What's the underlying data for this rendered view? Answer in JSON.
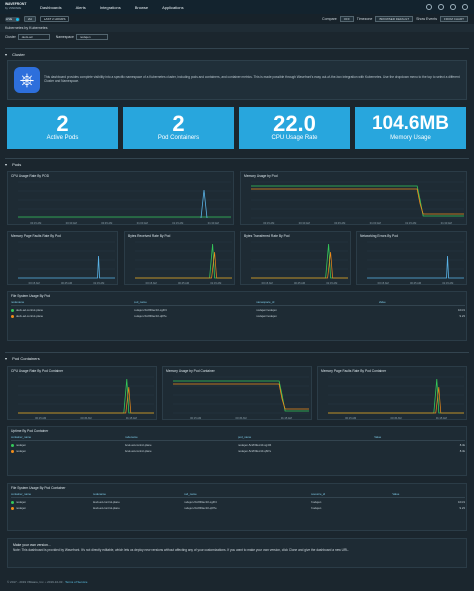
{
  "nav": {
    "logo_line1": "WAVEFRONT",
    "logo_line2": "by VMWARE",
    "menu": [
      "Dashboards",
      "Alerts",
      "Integrations",
      "Browse",
      "Applications"
    ]
  },
  "toolbar": {
    "toggle_label": "LIVE",
    "interval": "2H",
    "range": "LAST 2 HOURS",
    "compare_label": "Compare",
    "compare_value": "OFF",
    "timezone_label": "Timezone",
    "timezone_value": "BROWSER DEFAULT",
    "events_label": "Show Events",
    "events_value": "FROM CHART"
  },
  "breadcrumb": "Kubernetes by Kubernetes",
  "variables": {
    "cluster_label": "Cluster",
    "cluster_value": "devk-ad",
    "namespace_label": "Namespace",
    "namespace_value": "nodejen"
  },
  "sections": {
    "cluster": "Cluster",
    "pods": "Pods",
    "pod_containers": "Pod Containers"
  },
  "cluster_panel": {
    "description": "This dashboard provides complete visibility into a specific namespace of a Kubernetes cluster, including pods and containers, and container metrics. This is made possible through Wavefront's easy out-of-the-box integration with Kubernetes. Use the dropdown menu to the top to select a different Cluster and Namespace."
  },
  "stat_cards": [
    {
      "value": "2",
      "label": "Active Pods"
    },
    {
      "value": "2",
      "label": "Pod Containers"
    },
    {
      "value": "22.0",
      "label": "CPU Usage Rate"
    },
    {
      "value": "104.6MB",
      "label": "Memory Usage"
    }
  ],
  "panels": {
    "cpu_pod": "CPU Usage Rate By POD",
    "mem_pod": "Memory Usage by Pod",
    "pagefaults_pod": "Memory Page Faults Rate By Pod",
    "rx_pod": "Bytes Received Rate By Pod",
    "tx_pod": "Bytes Transferred Rate By Pod",
    "neterr_pod": "Networking Errors By Pod",
    "fs_pod": "File System Usage By Pod",
    "cpu_cont": "CPU Usage Rate By Pod Container",
    "mem_cont": "Memory Usage by Pod Container",
    "pf_cont": "Memory Page Faults Rate By Pod Container",
    "uptime_cont": "Uptime By Pod Container",
    "fs_cont": "File System Usage By Pod Container"
  },
  "x_ticks": [
    "00:15 AM",
    "00:30 AM",
    "00:45 AM",
    "01:00 AM",
    "01:15 AM",
    "01:30 AM"
  ],
  "x_ticks_small": [
    "00:15 AM",
    "00:45 AM",
    "01:15 AM"
  ],
  "fs_pod_table": {
    "headers": [
      "nodename",
      "pod_name",
      "namespace_id",
      "Value"
    ],
    "rows": [
      [
        "devk-ad-control-plane",
        "nodejen-5c2f49ec10-xg4f4",
        "nodejen/nodejen",
        "104.9"
      ],
      [
        "devk-ad-control-plane",
        "nodejen-5c2f49ec10-q6l7e",
        "nodejen/nodejen",
        "9.23"
      ]
    ],
    "colors": [
      "#34c759",
      "#f08c1a"
    ]
  },
  "uptime_table": {
    "headers": [
      "container_name",
      "nodename",
      "pod_name",
      "Value"
    ],
    "rows": [
      [
        "nodejen",
        "devk-ad-control-plane",
        "nodejen-5c2f49ec10-xg4f4",
        "8.4k"
      ],
      [
        "nodejen",
        "devk-ad-control-plane",
        "nodejen-5c2f49ec10-q6l7e",
        "8.4k"
      ]
    ],
    "colors": [
      "#34c759",
      "#f08c1a"
    ]
  },
  "fs_cont_table": {
    "headers": [
      "container_name",
      "nodename",
      "pod_name",
      "resource_id",
      "Value"
    ],
    "rows": [
      [
        "nodejen",
        "devk-ad-control-plane",
        "nodejen-5c2f49ec10-xg4f4",
        "/nodejen",
        "104.9"
      ],
      [
        "nodejen",
        "devk-ad-control-plane",
        "nodejen-5c2f49ec10-q6l7e",
        "/nodejen",
        "9.23"
      ]
    ],
    "colors": [
      "#34c759",
      "#f08c1a"
    ]
  },
  "view_label": "Value",
  "note": {
    "title": "Make your own version...",
    "text": "Note: This dashboard is provided by Wavefront. It's not directly editable, which lets us deploy new versions without affecting any of your customizations. If you want to make your own version, click Clone and give the dashboard a new URL."
  },
  "footer": {
    "copyright": "© 2017 - 2019 VMware, Inc. • 2019-10-03",
    "link": "Terms of Service"
  },
  "colors": {
    "accent": "#28a6dd",
    "series_green": "#34c759",
    "series_orange": "#f08c1a",
    "series_blue": "#5ab4e8"
  }
}
